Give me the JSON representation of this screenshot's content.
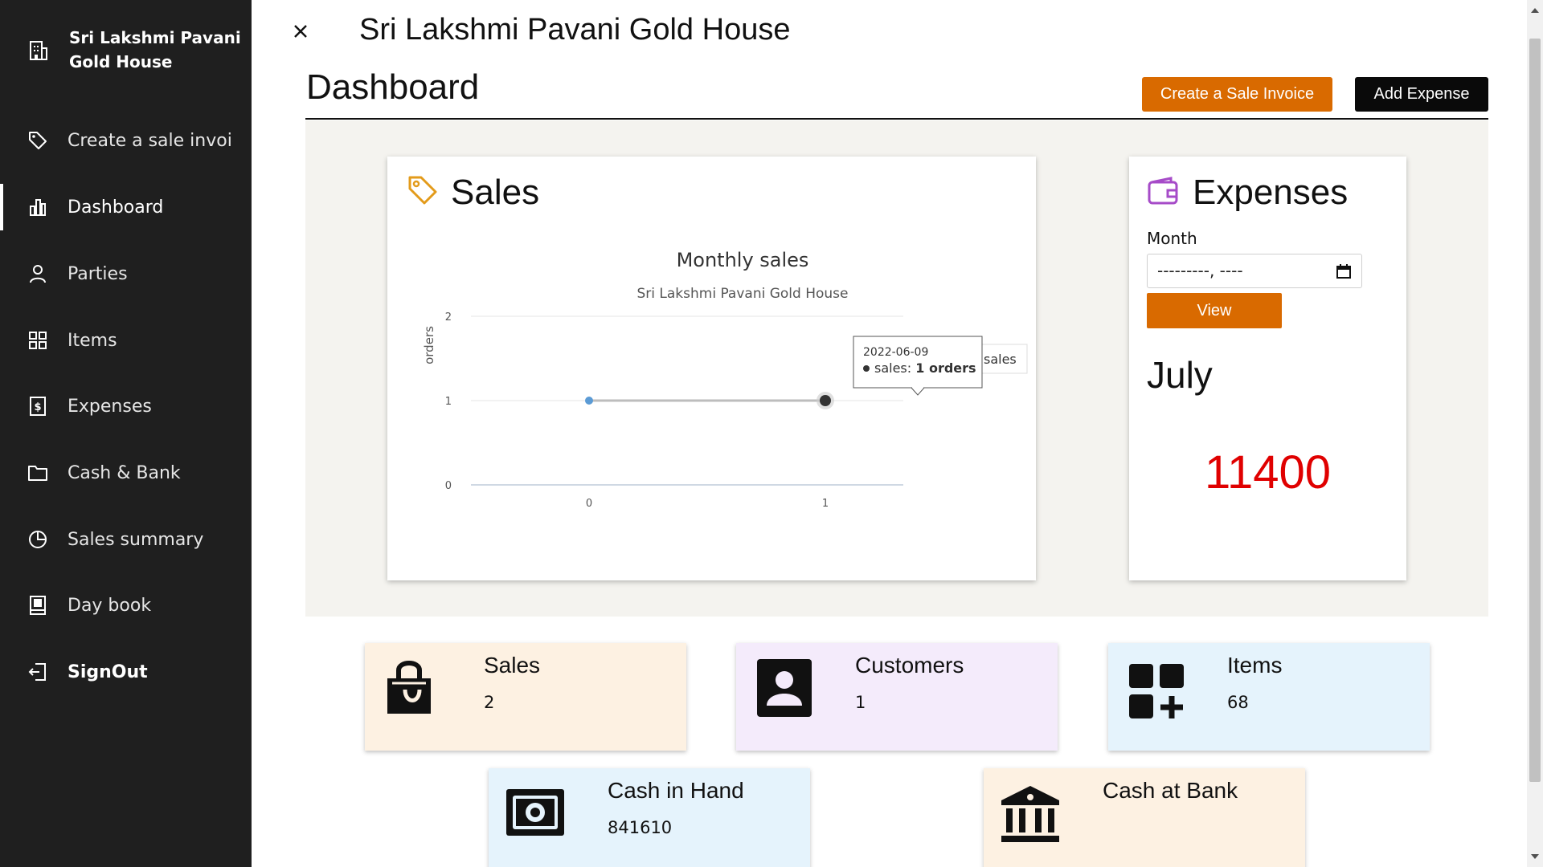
{
  "sidebar": {
    "brand": "Sri Lakshmi Pavani Gold House",
    "brand_icon": "building-icon",
    "items": [
      {
        "label": "Create a sale invoice",
        "icon": "tag-icon"
      },
      {
        "label": "Dashboard",
        "icon": "bar-chart-icon",
        "active": true
      },
      {
        "label": "Parties",
        "icon": "person-icon"
      },
      {
        "label": "Items",
        "icon": "grid-icon"
      },
      {
        "label": "Expenses",
        "icon": "receipt-icon"
      },
      {
        "label": "Cash & Bank",
        "icon": "folder-icon"
      },
      {
        "label": "Sales summary",
        "icon": "pie-chart-icon"
      },
      {
        "label": "Day book",
        "icon": "book-icon"
      },
      {
        "label": "SignOut",
        "icon": "sign-out-icon"
      }
    ]
  },
  "header": {
    "app_title": "Sri Lakshmi Pavani Gold House",
    "page_title": "Dashboard",
    "create_invoice_label": "Create a Sale Invoice",
    "add_expense_label": "Add Expense"
  },
  "sales_card": {
    "title": "Sales",
    "icon": "tag-icon",
    "tooltip": {
      "date": "2022-06-09",
      "series": "sales",
      "value_text": "1 orders"
    }
  },
  "chart_data": {
    "type": "line",
    "title": "Monthly sales",
    "subtitle": "Sri Lakshmi Pavani Gold House",
    "ylabel": "orders",
    "xlabel": "",
    "x": [
      0,
      1
    ],
    "series": [
      {
        "name": "sales",
        "values": [
          1,
          1
        ]
      }
    ],
    "xticks": [
      "0",
      "1"
    ],
    "yticks": [
      "0",
      "1",
      "2"
    ],
    "ylim": [
      0,
      2
    ],
    "legend": "top-right",
    "colors": {
      "line": "#bdbdbd",
      "point": "#5b9bd5",
      "hover_point": "#333333"
    }
  },
  "expenses_card": {
    "title": "Expenses",
    "icon": "wallet-icon",
    "month_label": "Month",
    "month_value": "---------, ----",
    "view_label": "View",
    "month_name": "July",
    "amount": "11400"
  },
  "tiles": [
    {
      "title": "Sales",
      "value": "2",
      "icon": "shopping-bag-icon",
      "bg": "#fdf1e2"
    },
    {
      "title": "Customers",
      "value": "1",
      "icon": "contact-icon",
      "bg": "#f4ebfb"
    },
    {
      "title": "Items",
      "value": "68",
      "icon": "add-grid-icon",
      "bg": "#e5f3fc"
    },
    {
      "title": "Cash in Hand",
      "value": "841610",
      "icon": "cash-icon",
      "bg": "#e5f3fc"
    },
    {
      "title": "Cash at Bank",
      "value": "",
      "icon": "bank-icon",
      "bg": "#fdf1e2"
    }
  ],
  "colors": {
    "accent": "#d96a00",
    "sidebar": "#1f1f1f",
    "amount": "#e00000"
  }
}
